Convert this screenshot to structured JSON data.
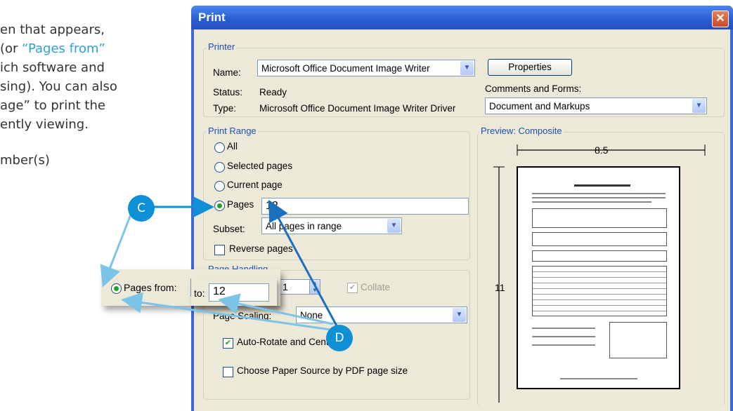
{
  "tutorial": {
    "line1": "en that appears,",
    "line2_pre": " (or ",
    "line2_link": "“Pages from”",
    "line3": "ich software and",
    "line4": "sing). You can also",
    "line5": "age” to print the",
    "line6": "ently viewing.",
    "line7": "mber(s)"
  },
  "dialog": {
    "title": "Print",
    "printer": {
      "group_label": "Printer",
      "name_label": "Name:",
      "name_value": "Microsoft Office Document Image Writer",
      "status_label": "Status:",
      "status_value": "Ready",
      "type_label": "Type:",
      "type_value": "Microsoft Office Document Image Writer Driver",
      "properties_button": "Properties",
      "comments_label": "Comments and Forms:",
      "comments_value": "Document and Markups"
    },
    "range": {
      "group_label": "Print Range",
      "all": "All",
      "selected": "Selected pages",
      "current": "Current page",
      "pages": "Pages",
      "pages_value": "12",
      "subset_label": "Subset:",
      "subset_value": "All pages in range",
      "reverse": "Reverse pages"
    },
    "handling": {
      "group_label": "Page Handling",
      "copies_value": "1",
      "collate": "Collate",
      "scaling_label": "Page Scaling:",
      "scaling_value": "None",
      "auto_rotate": "Auto-Rotate and Center",
      "choose_source": "Choose Paper Source by PDF page size"
    },
    "preview": {
      "label": "Preview: Composite",
      "width": "8.5",
      "height": "11"
    }
  },
  "zoom": {
    "pages_from": "Pages from:",
    "from_value": "12",
    "to_label": "to:",
    "to_value": "12"
  },
  "badges": {
    "c": "C",
    "d": "D"
  },
  "colors": {
    "accent": "#0f8fd6",
    "callout_line": "#7cc3e8",
    "title_blue": "#2a5bd0"
  }
}
